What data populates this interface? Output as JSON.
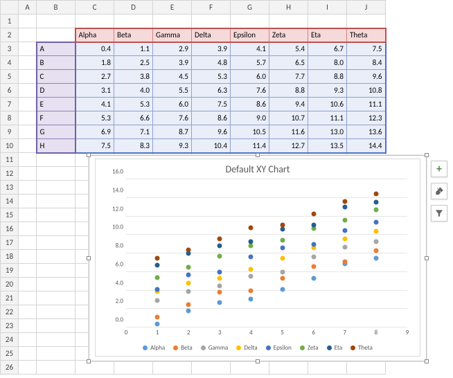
{
  "sheet": {
    "col_letters": [
      "A",
      "B",
      "C",
      "D",
      "E",
      "F",
      "G",
      "H",
      "I",
      "J"
    ],
    "row_count": 26,
    "headers": [
      "Alpha",
      "Beta",
      "Gamma",
      "Delta",
      "Epsilon",
      "Zeta",
      "Eta",
      "Theta"
    ],
    "categories": [
      "A",
      "B",
      "C",
      "D",
      "E",
      "F",
      "G",
      "H"
    ],
    "data": [
      [
        0.4,
        1.1,
        2.9,
        3.9,
        4.1,
        5.4,
        6.7,
        7.5
      ],
      [
        1.8,
        2.5,
        3.9,
        4.8,
        5.7,
        6.5,
        8.0,
        8.4
      ],
      [
        2.7,
        3.8,
        4.5,
        5.3,
        6.0,
        7.7,
        8.8,
        9.6
      ],
      [
        3.1,
        4.0,
        5.5,
        6.3,
        7.6,
        8.8,
        9.3,
        10.8
      ],
      [
        4.1,
        5.3,
        6.0,
        7.5,
        8.6,
        9.4,
        10.6,
        11.1
      ],
      [
        5.3,
        6.6,
        7.6,
        8.6,
        9.0,
        10.7,
        11.1,
        12.3
      ],
      [
        6.9,
        7.1,
        8.7,
        9.6,
        10.5,
        11.6,
        13.0,
        13.6
      ],
      [
        7.5,
        8.3,
        9.3,
        10.4,
        11.4,
        12.7,
        13.5,
        14.4
      ]
    ]
  },
  "chart_data": {
    "type": "scatter",
    "title": "Default XY Chart",
    "xlabel": "",
    "ylabel": "",
    "xlim": [
      0,
      9
    ],
    "ylim": [
      0,
      16
    ],
    "xticks": [
      0,
      1,
      2,
      3,
      4,
      5,
      6,
      7,
      8,
      9
    ],
    "yticks": [
      0.0,
      2.0,
      4.0,
      6.0,
      8.0,
      10.0,
      12.0,
      14.0,
      16.0
    ],
    "x": [
      1,
      2,
      3,
      4,
      5,
      6,
      7,
      8
    ],
    "series": [
      {
        "name": "Alpha",
        "color": "#5b9bd5",
        "values": [
          0.4,
          1.8,
          2.7,
          3.1,
          4.1,
          5.3,
          6.9,
          7.5
        ]
      },
      {
        "name": "Beta",
        "color": "#ed7d31",
        "values": [
          1.1,
          2.5,
          3.8,
          4.0,
          5.3,
          6.6,
          7.1,
          8.3
        ]
      },
      {
        "name": "Gamma",
        "color": "#a5a5a5",
        "values": [
          2.9,
          3.9,
          4.5,
          5.5,
          6.0,
          7.6,
          8.7,
          9.3
        ]
      },
      {
        "name": "Delta",
        "color": "#ffc000",
        "values": [
          3.9,
          4.8,
          5.3,
          6.3,
          7.5,
          8.6,
          9.6,
          10.4
        ]
      },
      {
        "name": "Epsilon",
        "color": "#4472c4",
        "values": [
          4.1,
          5.7,
          6.0,
          7.6,
          8.6,
          9.0,
          10.5,
          11.4
        ]
      },
      {
        "name": "Zeta",
        "color": "#70ad47",
        "values": [
          5.4,
          6.5,
          7.7,
          8.8,
          9.4,
          10.7,
          11.6,
          12.7
        ]
      },
      {
        "name": "Eta",
        "color": "#255e91",
        "values": [
          6.7,
          8.0,
          8.8,
          9.3,
          10.6,
          11.1,
          13.0,
          13.5
        ]
      },
      {
        "name": "Theta",
        "color": "#9e480e",
        "values": [
          7.5,
          8.4,
          9.6,
          10.8,
          11.1,
          12.3,
          13.6,
          14.4
        ]
      }
    ]
  },
  "flyout": {
    "plus": "chart-elements-button",
    "brush": "chart-styles-button",
    "filter": "chart-filters-button"
  }
}
